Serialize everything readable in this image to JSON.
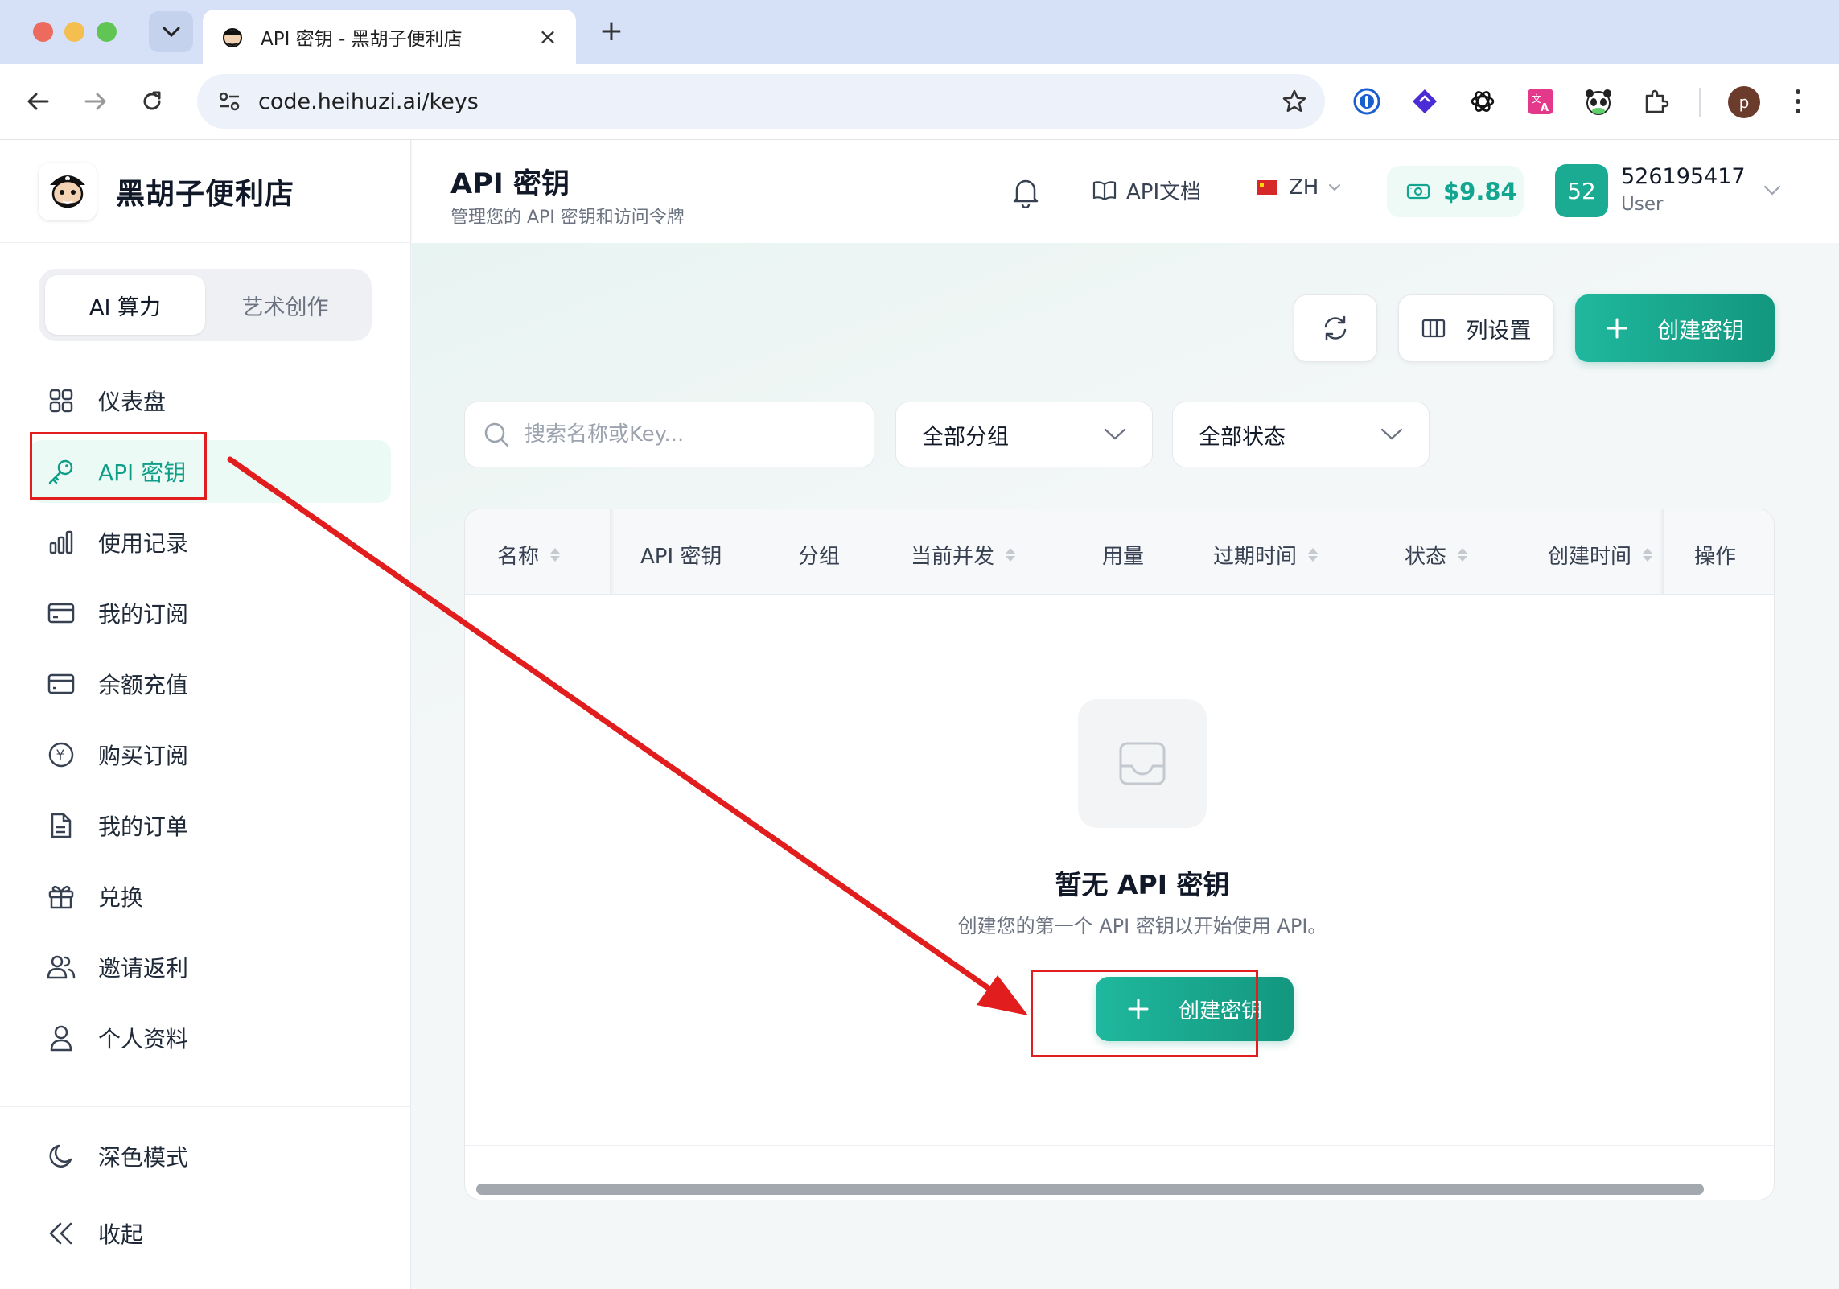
{
  "browser": {
    "tab_title": "API 密钥 - 黑胡子便利店",
    "url": "code.heihuzi.ai/keys",
    "profile_initial": "p",
    "extensions": [
      "1password-icon",
      "extension-diamond-icon",
      "openai-icon",
      "translate-icon",
      "panda-icon",
      "puzzle-extensions-icon"
    ]
  },
  "sidebar": {
    "brand": "黑胡子便利店",
    "modes": [
      {
        "label": "AI 算力",
        "active": true
      },
      {
        "label": "艺术创作",
        "active": false
      }
    ],
    "items": [
      {
        "label": "仪表盘",
        "icon": "grid-icon"
      },
      {
        "label": "API 密钥",
        "icon": "key-icon",
        "active": true
      },
      {
        "label": "使用记录",
        "icon": "bar-chart-icon"
      },
      {
        "label": "我的订阅",
        "icon": "credit-card-icon"
      },
      {
        "label": "余额充值",
        "icon": "wallet-card-icon"
      },
      {
        "label": "购买订阅",
        "icon": "yen-circle-icon"
      },
      {
        "label": "我的订单",
        "icon": "document-icon"
      },
      {
        "label": "兑换",
        "icon": "gift-icon"
      },
      {
        "label": "邀请返利",
        "icon": "users-icon"
      },
      {
        "label": "个人资料",
        "icon": "user-icon"
      }
    ],
    "footer": {
      "dark_mode": "深色模式",
      "collapse": "收起"
    }
  },
  "header": {
    "title": "API 密钥",
    "subtitle": "管理您的 API 密钥和访问令牌",
    "docs": "API文档",
    "lang": "ZH",
    "balance": "$9.84",
    "avatar": "52",
    "user_id": "526195417",
    "role": "User"
  },
  "toolbar": {
    "column_settings": "列设置",
    "create_key": "创建密钥"
  },
  "filters": {
    "search_placeholder": "搜索名称或Key...",
    "group": "全部分组",
    "status": "全部状态"
  },
  "table": {
    "columns": [
      "名称",
      "API 密钥",
      "分组",
      "当前并发",
      "用量",
      "过期时间",
      "状态",
      "创建时间",
      "操作"
    ],
    "rows": []
  },
  "empty_state": {
    "title": "暂无 API 密钥",
    "description": "创建您的第一个 API 密钥以开始使用 API。",
    "button": "创建密钥"
  },
  "colors": {
    "accent": "#13977f",
    "accent_light": "#ecfaf6",
    "annotation": "#e11d1d"
  }
}
